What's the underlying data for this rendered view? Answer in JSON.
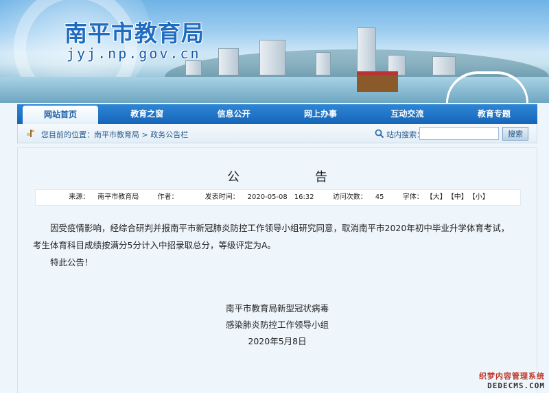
{
  "header": {
    "site_name": "南平市教育局",
    "domain": "jyj.np.gov.cn"
  },
  "nav": {
    "items": [
      {
        "label": "网站首页",
        "active": true
      },
      {
        "label": "教育之窗"
      },
      {
        "label": "信息公开"
      },
      {
        "label": "网上办事"
      },
      {
        "label": "互动交流"
      },
      {
        "label": "教育专题"
      }
    ]
  },
  "location": {
    "prefix": "您目前的位置：",
    "crumbs": [
      "南平市教育局",
      "政务公告栏"
    ],
    "separator": " > "
  },
  "search": {
    "label": "站内搜索：",
    "value": "",
    "button": "搜索"
  },
  "article": {
    "title": "公告",
    "meta": {
      "source_label": "来源：",
      "source": "南平市教育局",
      "author_label": "作者：",
      "author": "",
      "time_label": "发表时间：",
      "time": "2020-05-08　16:32",
      "views_label": "访问次数：",
      "views": "45",
      "font_label": "字体：",
      "font_large": "【大】",
      "font_medium": "【中】",
      "font_small": "【小】"
    },
    "paragraphs": [
      "因受疫情影响，经综合研判并报南平市新冠肺炎防控工作领导小组研究同意，取消南平市2020年初中毕业升学体育考试，",
      "考生体育科目成绩按满分5分计入中招录取总分，等级评定为A。",
      "特此公告！"
    ],
    "signature": {
      "line1": "南平市教育局新型冠状病毒",
      "line2": "感染肺炎防控工作领导小组",
      "date": "2020年5月8日"
    }
  },
  "watermark": {
    "cn": "织梦内容管理系统",
    "en": "DEDECMS.COM"
  },
  "colors": {
    "nav_bg": "#1a6fc2",
    "title_blue": "#1f6cc0",
    "page_bg": "#eef5fb"
  }
}
